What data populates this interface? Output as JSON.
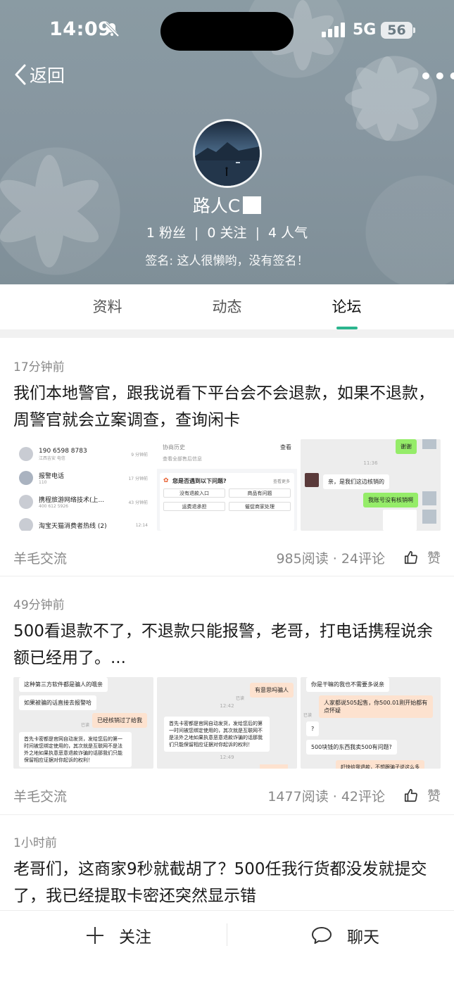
{
  "status_bar": {
    "time": "14:09",
    "network": "5G",
    "battery": "56"
  },
  "header": {
    "back_label": "返回",
    "username": "路人C",
    "stats": [
      "1 粉丝",
      "0 关注",
      "4 人气"
    ],
    "signature": "签名: 这人很懒哟，没有签名！"
  },
  "tabs": [
    {
      "label": "资料",
      "active": false
    },
    {
      "label": "动态",
      "active": false
    },
    {
      "label": "论坛",
      "active": true
    }
  ],
  "accent_color": "#2bb58e",
  "posts": [
    {
      "time": "17分钟前",
      "title": "我们本地警官，跟我说看下平台会不会退款，如果不退款，周警官就会立案调查，查询闲卡",
      "source": "羊毛交流",
      "metrics": "985阅读 · 24评论",
      "like_label": "赞",
      "images": {
        "call_log": [
          {
            "name": "190 6598 8783",
            "sub": "江西吉安 电信",
            "time": "9 分钟前"
          },
          {
            "name": "报警电话",
            "sub": "110",
            "time": "17 分钟前"
          },
          {
            "name": "携程旅游网络技术(上...",
            "sub": "400 612 5926",
            "time": "43 分钟前"
          },
          {
            "name": "淘宝天猫消费者热线 (2)",
            "sub": "",
            "time": "12:14"
          }
        ],
        "help": {
          "history": "协商历史",
          "view": "查看",
          "all_after_sales": "查看全部售后信息",
          "question": "您是否遇到以下问题?",
          "more": "查看更多",
          "options": [
            "没有退款入口",
            "商品有问题",
            "运费退承担",
            "催促商家处理"
          ]
        },
        "chat": {
          "thanks": "谢谢",
          "time": "11:36",
          "reply": "亲，是我们这边核销的",
          "mine": "我账号没有核销啊"
        }
      }
    },
    {
      "time": "49分钟前",
      "title": "500看退款不了，不退款只能报警，老哥，打电话携程说余额已经用了。...",
      "source": "羊毛交流",
      "metrics": "1477阅读 · 42评论",
      "like_label": "赞",
      "images": {
        "chat1": {
          "m1": "这种第三方软件都是骗人的哦亲",
          "m2": "如果被骗的话直接去报警哈",
          "read": "已读",
          "m3": "已经核销过了给我",
          "m4": "首先卡密都是官网自动发货，发给您后的第一时间被您绑定使用的，其次就是互联网不是法外之地如果执意恶意退款诈骗的话那我们只能保留相应证据对你起诉的权利！"
        },
        "chat2": {
          "m1": "有意思吗骗人",
          "read": "已读",
          "time": "12:42",
          "m2": "首先卡密都是官网自动发货，发给您后的第一时间被您绑定使用的，其次就是互联网不是法外之地如果执意恶意退款诈骗的话那我们只能保留相应证据对你起诉的权利！",
          "time2": "12:49"
        },
        "chat3": {
          "m1": "你是干嘛的我也不需要多说亲",
          "m2": "人家都说505起售，你500.01刚开始都有点怀疑",
          "read": "已读",
          "m3": "?",
          "m4": "500块钱的东西我卖500有问题?",
          "m5": "赶快给我退款，不想跟骗子说这么多"
        }
      }
    },
    {
      "time": "1小时前",
      "title": "老哥们，这商家9秒就截胡了？500任我行货都没发就提交了，我已经提取卡密还突然显示错"
    }
  ],
  "bottom_bar": {
    "follow": "关注",
    "chat": "聊天"
  }
}
